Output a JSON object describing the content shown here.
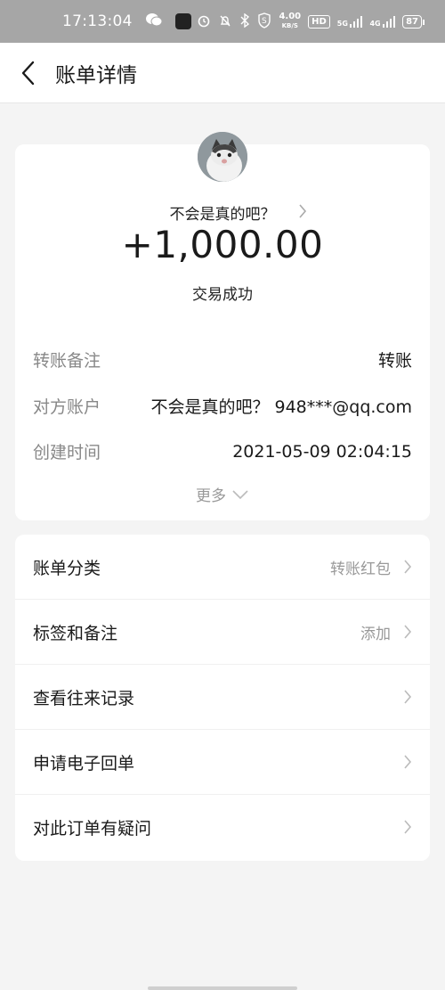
{
  "status_bar": {
    "time": "17:13:04",
    "net_speed": "4.00",
    "net_unit": "KB/S",
    "hd_label": "HD",
    "net5g": "5G",
    "net4g": "4G",
    "battery": "87"
  },
  "header": {
    "title": "账单详情"
  },
  "summary": {
    "counterparty_name": "不会是真的吧？",
    "amount": "+1,000.00",
    "status": "交易成功"
  },
  "details": [
    {
      "label": "转账备注",
      "value": "转账"
    },
    {
      "label": "对方账户",
      "value": "不会是真的吧？ 948***@qq.com"
    },
    {
      "label": "创建时间",
      "value": "2021-05-09 02:04:15"
    }
  ],
  "more_label": "更多",
  "menu": [
    {
      "label": "账单分类",
      "value": "转账红包"
    },
    {
      "label": "标签和备注",
      "value": "添加"
    },
    {
      "label": "查看往来记录",
      "value": ""
    },
    {
      "label": "申请电子回单",
      "value": ""
    },
    {
      "label": "对此订单有疑问",
      "value": ""
    }
  ]
}
